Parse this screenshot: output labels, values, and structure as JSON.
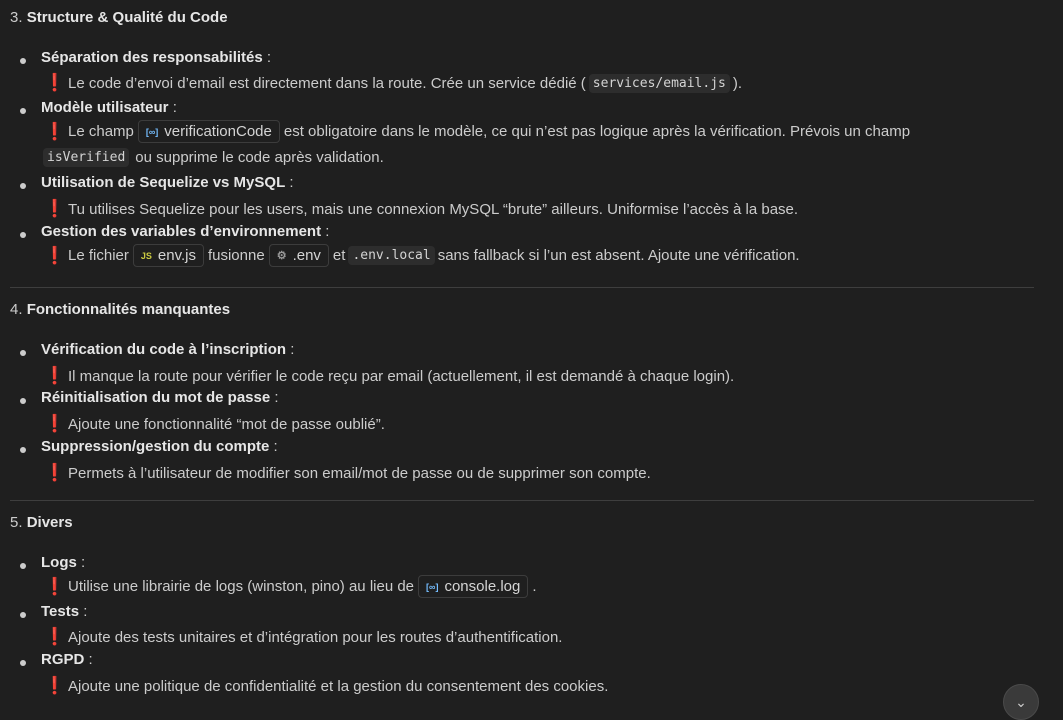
{
  "sections": [
    {
      "number": "3.",
      "title": "Structure & Qualité du Code",
      "items": [
        {
          "label": "Séparation des responsabilités",
          "colon": " :",
          "text1": "Le code d’envoi d’email est directement dans la route. Crée un service dédié (",
          "code1": "services/email.js",
          "text2": ")."
        },
        {
          "label": "Modèle utilisateur",
          "colon": " :",
          "text1": "Le champ",
          "chip1": "verificationCode",
          "text2": "est obligatoire dans le modèle, ce qui n’est pas logique après la vérification. Prévois un champ",
          "code1": "isVerified",
          "text3": "ou supprime le code après validation."
        },
        {
          "label": "Utilisation de Sequelize vs MySQL",
          "colon": " :",
          "text1": "Tu utilises Sequelize pour les users, mais une connexion MySQL “brute” ailleurs. Uniformise l’accès à la base."
        },
        {
          "label": "Gestion des variables d’environnement",
          "colon": " :",
          "text1": "Le fichier",
          "chip1": "env.js",
          "text2": "fusionne",
          "chip2": ".env",
          "text3": "et",
          "code1": ".env.local",
          "text4": "sans fallback si l’un est absent. Ajoute une vérification."
        }
      ]
    },
    {
      "number": "4.",
      "title": "Fonctionnalités manquantes",
      "items": [
        {
          "label": "Vérification du code à l’inscription",
          "colon": " :",
          "text1": "Il manque la route pour vérifier le code reçu par email (actuellement, il est demandé à chaque login)."
        },
        {
          "label": "Réinitialisation du mot de passe",
          "colon": " :",
          "text1": "Ajoute une fonctionnalité “mot de passe oublié”."
        },
        {
          "label": "Suppression/gestion du compte",
          "colon": " :",
          "text1": "Permets à l’utilisateur de modifier son email/mot de passe ou de supprimer son compte."
        }
      ]
    },
    {
      "number": "5.",
      "title": "Divers",
      "items": [
        {
          "label": "Logs",
          "colon": " :",
          "text1": "Utilise une librairie de logs (winston, pino) au lieu de",
          "chip1": "console.log",
          "text2": "."
        },
        {
          "label": "Tests",
          "colon": " :",
          "text1": "Ajoute des tests unitaires et d’intégration pour les routes d’authentification."
        },
        {
          "label": "RGPD",
          "colon": " :",
          "text1": "Ajoute une politique de confidentialité et la gestion du consentement des cookies."
        }
      ]
    }
  ],
  "glyphs": {
    "exclamation": "❗",
    "bracket_icon": "[∞]",
    "js_icon": "JS",
    "gear_icon": "⚙",
    "chevron_down": "⌄"
  },
  "colors": {
    "background": "#1f1f1f",
    "text": "#cccccc",
    "exclamation": "#f14c4c",
    "bracket_icon": "#75beff",
    "js_icon": "#cbcb41"
  }
}
